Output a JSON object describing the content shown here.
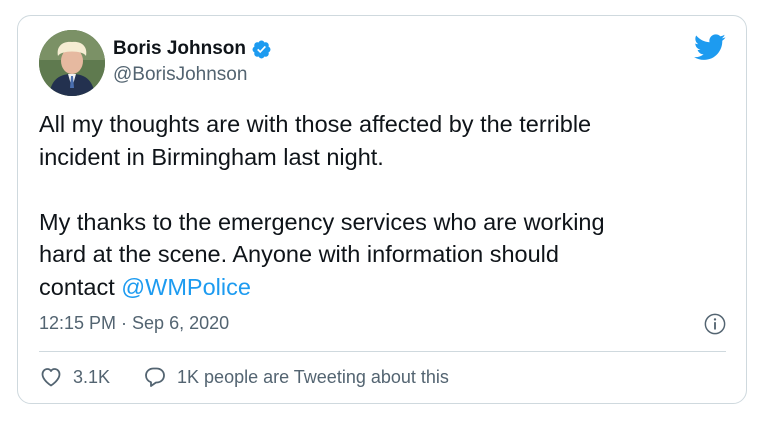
{
  "author": {
    "display_name": "Boris Johnson",
    "handle": "@BorisJohnson",
    "verified": true
  },
  "tweet": {
    "line1": "All my thoughts are with those affected by the terrible\nincident in Birmingham last night.",
    "line2": "My thanks to the emergency services who are working\nhard at the scene. Anyone with information should\ncontact ",
    "mention": "@WMPolice",
    "timestamp": "12:15 PM · Sep 6, 2020"
  },
  "actions": {
    "likes": "3.1K",
    "replies_label": "1K people are Tweeting about this"
  },
  "icons": {
    "brand": "twitter-bird-icon",
    "verified": "verified-badge-icon",
    "info": "info-icon",
    "like": "heart-icon",
    "reply": "speech-bubble-icon"
  },
  "colors": {
    "accent": "#1d9bf0",
    "text": "#0f1419",
    "muted": "#536471",
    "border": "#cfd9de"
  }
}
